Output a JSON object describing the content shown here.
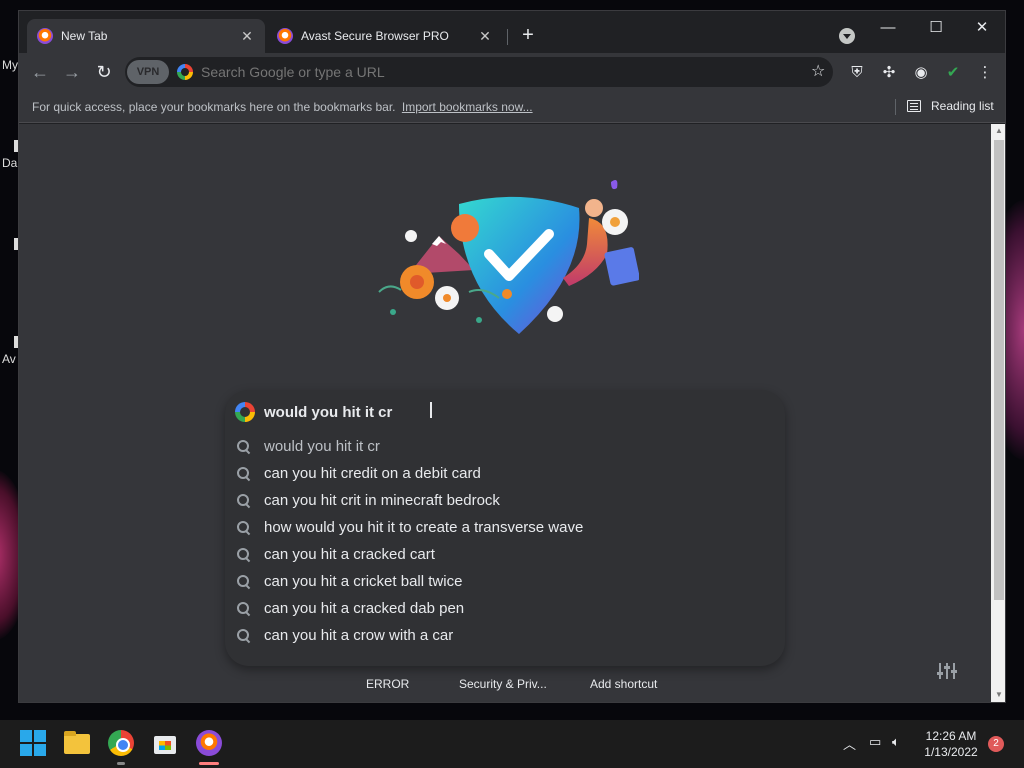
{
  "desktop": {
    "labels": [
      "My",
      "Da",
      "Av"
    ]
  },
  "tabs": [
    {
      "title": "New Tab",
      "active": true
    },
    {
      "title": "Avast Secure Browser PRO",
      "active": false
    }
  ],
  "toolbar": {
    "vpn_label": "VPN",
    "omnibox_placeholder": "Search Google or type a URL"
  },
  "bookmarks_bar": {
    "hint": "For quick access, place your bookmarks here on the bookmarks bar.",
    "import_link": "Import bookmarks now...",
    "reading_list": "Reading list"
  },
  "search": {
    "query": "would you hit it cr",
    "suggestions": [
      "would you hit it cr",
      "can you hit credit on a debit card",
      "can you hit crit in minecraft bedrock",
      "how would you hit it to create a transverse wave",
      "can you hit a cracked cart",
      "can you hit a cricket ball twice",
      "can you hit a cracked dab pen",
      "can you hit a crow with a car"
    ]
  },
  "shortcuts": [
    {
      "label": "ERROR"
    },
    {
      "label": "Security & Priv..."
    },
    {
      "label": "Add shortcut"
    }
  ],
  "taskbar": {
    "time": "12:26 AM",
    "date": "1/13/2022",
    "notification_count": "2"
  },
  "colors": {
    "page_bg": "#35363a",
    "accent_orange": "#ff7800",
    "accent_purple": "#8a4bd8",
    "shield_teal": "#2dd4c8"
  }
}
